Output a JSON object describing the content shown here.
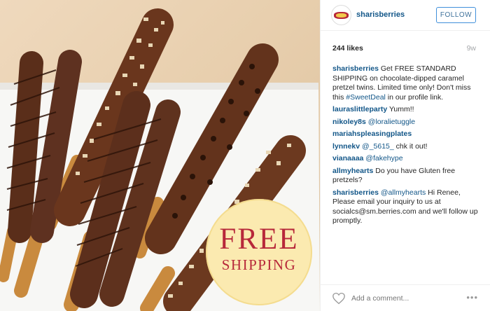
{
  "post": {
    "badge_line1": "FREE",
    "badge_line2": "SHIPPING"
  },
  "header": {
    "username": "sharisberries",
    "follow_label": "FOLLOW",
    "avatar_icon": "sharisberries-logo"
  },
  "meta": {
    "likes": "244 likes",
    "age": "9w"
  },
  "caption": {
    "user": "sharisberries",
    "text_before": "Get FREE STANDARD SHIPPING on chocolate-dipped caramel pretzel twins. Limited time only! Don't miss this ",
    "hashtag": "#SweetDeal",
    "text_after": " in our profile link."
  },
  "comments": [
    {
      "user": "lauraslittleparty",
      "text": "Yumm!! ",
      "emoji": ""
    },
    {
      "user": "nikoley8s",
      "text": "@loralietuggle"
    },
    {
      "user": "mariahspleasingplates",
      "text": ""
    },
    {
      "user": "lynnekv",
      "text_mention": "@_5615_",
      "text": " chk it out!"
    },
    {
      "user": "vianaaaa",
      "text": "@fakehype "
    },
    {
      "user": "allmyhearts",
      "text": "Do you have Gluten free pretzels?"
    },
    {
      "user": "sharisberries",
      "text_mention": "@allmyhearts",
      "text": " Hi Renee, Please email your inquiry to us at socialcs@sm.berries.com and we'll follow up promptly."
    }
  ],
  "footer": {
    "add_comment_placeholder": "Add a comment...",
    "like_icon": "heart-icon",
    "more_label": "•••",
    "more_icon": "more-options-icon"
  },
  "colors": {
    "username_blue": "#125688",
    "follow_border": "#4090db",
    "badge_red": "#b7283a",
    "badge_bg": "#fbeab0"
  }
}
